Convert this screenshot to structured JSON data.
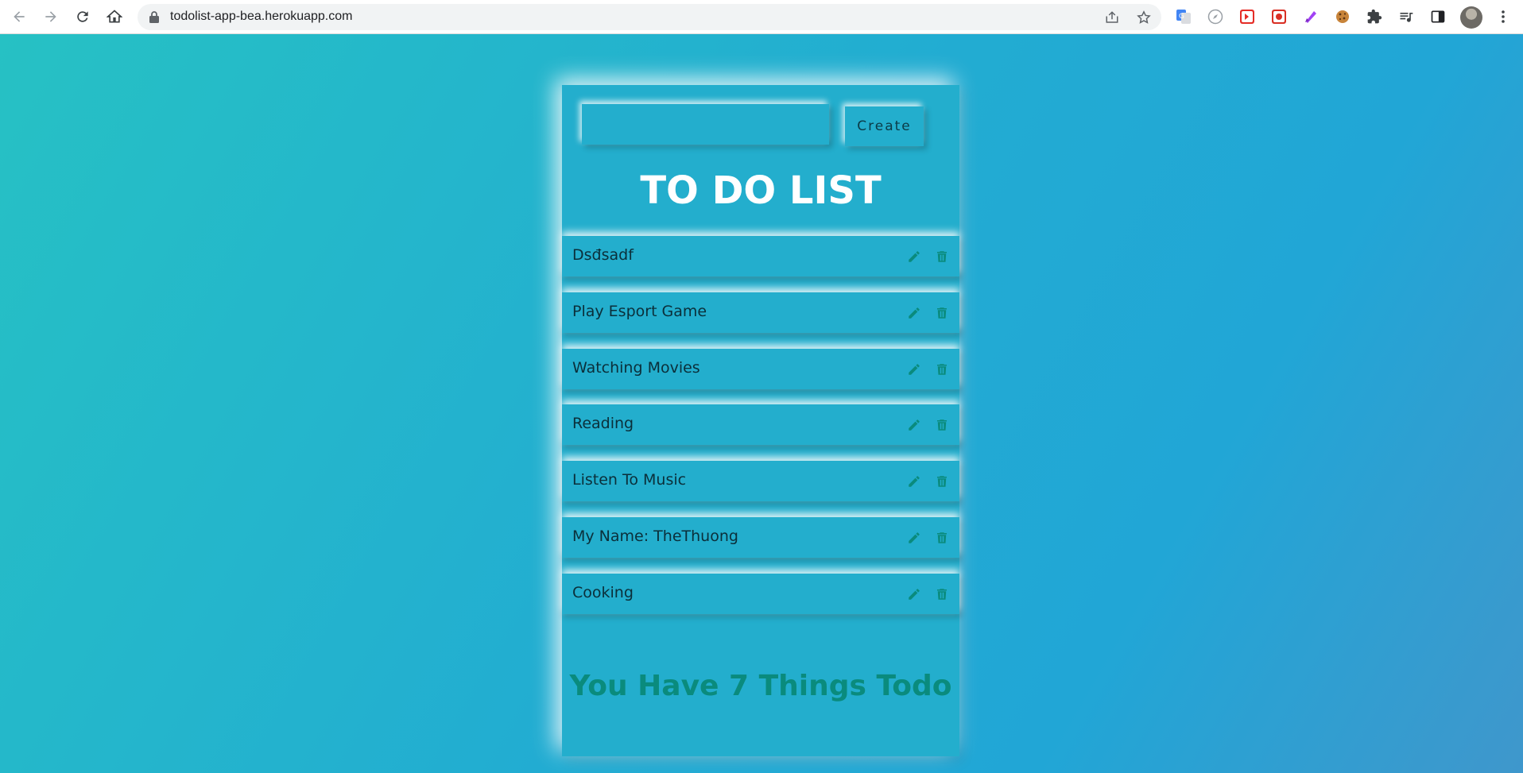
{
  "browser": {
    "url": "todolist-app-bea.herokuapp.com",
    "extensions": [
      "google-translate-icon",
      "compass-icon",
      "youtube-red-icon",
      "record-icon",
      "purple-extension-icon",
      "cookie-icon",
      "puzzle-icon",
      "media-queue-icon",
      "side-panel-icon"
    ]
  },
  "app": {
    "input_value": "",
    "create_label": "Create",
    "title": "TO DO LIST",
    "tasks": [
      {
        "text": "Dsđsadf"
      },
      {
        "text": "Play Esport Game"
      },
      {
        "text": "Watching Movies"
      },
      {
        "text": "Reading"
      },
      {
        "text": "Listen To Music"
      },
      {
        "text": "My Name: TheThuong"
      },
      {
        "text": "Cooking"
      }
    ],
    "summary": "You Have 7 Things Todo",
    "colors": {
      "background": "#23aecd",
      "title": "#ffffff",
      "icon": "#0a8b7d",
      "summary": "#0a8b7d"
    }
  }
}
